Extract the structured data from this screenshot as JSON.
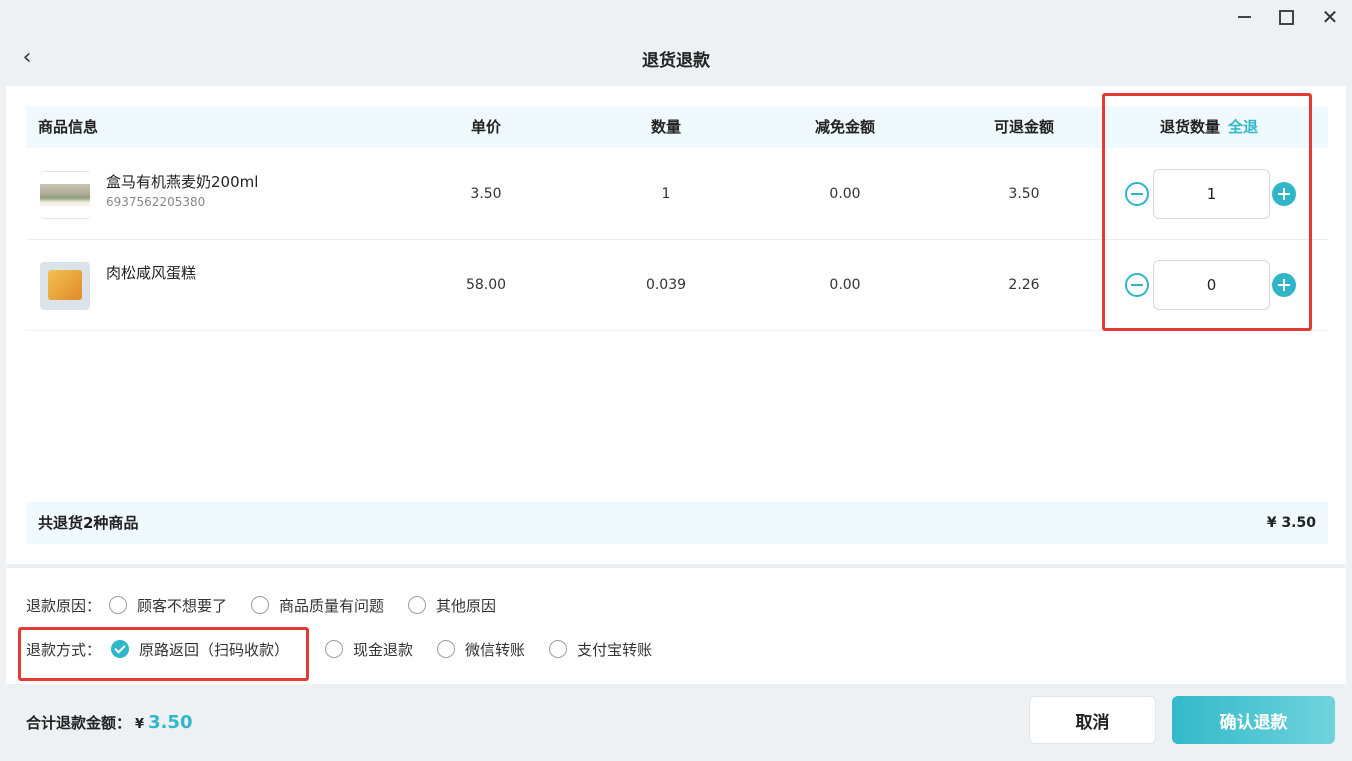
{
  "header": {
    "title": "退货退款",
    "back_icon": "chevron-left-icon"
  },
  "window": {
    "minimize_icon": "minimize-icon",
    "maximize_icon": "maximize-icon",
    "close_icon": "close-icon"
  },
  "table": {
    "columns": {
      "info": "商品信息",
      "price": "单价",
      "qty": "数量",
      "discount": "减免金额",
      "refundable": "可退金额",
      "return_qty": "退货数量",
      "return_all": "全退"
    },
    "rows": [
      {
        "name": "盒马有机燕麦奶200ml",
        "code": "6937562205380",
        "price": "3.50",
        "qty": "1",
        "discount": "0.00",
        "refundable": "3.50",
        "return_qty": "1"
      },
      {
        "name": "肉松咸风蛋糕",
        "code": "",
        "price": "58.00",
        "qty": "0.039",
        "discount": "0.00",
        "refundable": "2.26",
        "return_qty": "0"
      }
    ]
  },
  "summary": {
    "label": "共退货2种商品",
    "total": "¥ 3.50"
  },
  "reason": {
    "label": "退款原因：",
    "options": [
      "顾客不想要了",
      "商品质量有问题",
      "其他原因"
    ]
  },
  "method": {
    "label": "退款方式：",
    "options": [
      "原路返回（扫码收款）",
      "现金退款",
      "微信转账",
      "支付宝转账"
    ],
    "selected_index": 0
  },
  "footer": {
    "total_label": "合计退款金额：",
    "currency": "¥",
    "total_value": "3.50",
    "cancel_label": "取消",
    "confirm_label": "确认退款"
  },
  "colors": {
    "accent": "#2fb7c9",
    "highlight": "#e53935"
  }
}
